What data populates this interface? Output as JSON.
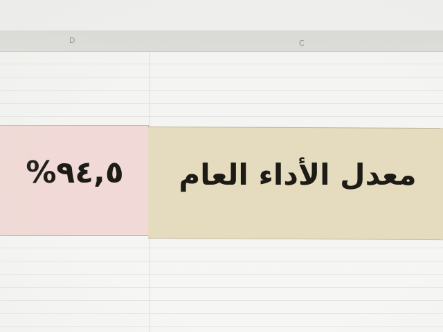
{
  "sheet": {
    "columns": [
      {
        "letter": "D"
      },
      {
        "letter": "C"
      }
    ],
    "summary_row": {
      "label": "معدل الأداء العام",
      "value": "%٩٤,٥"
    }
  },
  "colors": {
    "value_cell_bg": "#f0d9d6",
    "label_cell_bg": "#e5dbbf",
    "header_bg": "#d9d9d6",
    "text": "#1d1b16"
  }
}
